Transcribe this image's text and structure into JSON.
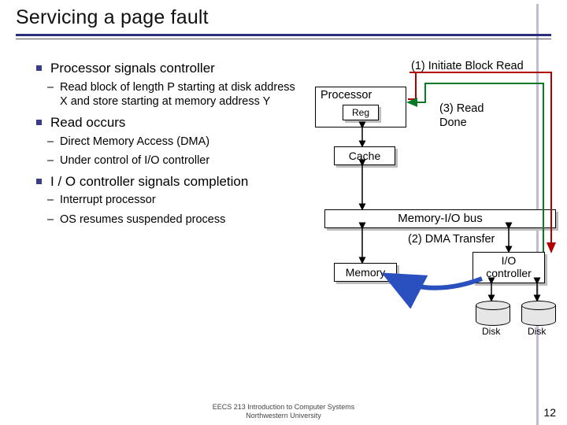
{
  "title": "Servicing a page fault",
  "bullets": {
    "b1": "Processor signals controller",
    "b1a": "Read block of length P starting at disk address X and store starting at memory address Y",
    "b2": "Read occurs",
    "b2a": "Direct Memory Access (DMA)",
    "b2b": "Under control of I/O controller",
    "b3": "I / O controller signals completion",
    "b3a": "Interrupt processor",
    "b3b": "OS resumes suspended process"
  },
  "diagram": {
    "step1": "(1) Initiate Block Read",
    "step2": "(2) DMA Transfer",
    "step3_l1": "(3) Read",
    "step3_l2": "Done",
    "processor": "Processor",
    "reg": "Reg",
    "cache": "Cache",
    "bus": "Memory-I/O bus",
    "memory": "Memory",
    "ioctrl_l1": "I/O",
    "ioctrl_l2": "controller",
    "disk": "Disk"
  },
  "footer": {
    "l1": "EECS 213 Introduction to Computer Systems",
    "l2": "Northwestern University"
  },
  "page": "12"
}
